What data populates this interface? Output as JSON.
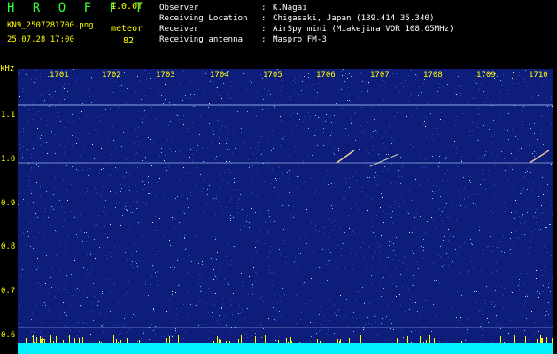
{
  "header": {
    "logo": "H R O F F T",
    "version": "1.0.0f",
    "filename": "KN9_2507281700.png",
    "mode_label": "meteor",
    "timestamp": "25.07.28 17:00",
    "count": "82"
  },
  "station_info": [
    {
      "key": "Observer",
      "value": "K.Nagai"
    },
    {
      "key": "Receiving Location",
      "value": "Chigasaki, Japan (139.414 35.340)"
    },
    {
      "key": "Receiver",
      "value": "AirSpy mini (Miakejima VOR 108.65MHz)"
    },
    {
      "key": "Receiving antenna",
      "value": "Maspro FM-3"
    }
  ],
  "spectrogram": {
    "y_unit": "kHz",
    "y_ticks": [
      "1.1",
      "1.0",
      "0.9",
      "0.8",
      "0.7",
      "0.6"
    ],
    "x_ticks": [
      "1701",
      "1702",
      "1703",
      "1704",
      "1705",
      "1706",
      "1707",
      "1708",
      "1709",
      "1710"
    ],
    "colors": {
      "background": "#0f1d7a",
      "noise_dim": "#2b49c9",
      "noise_bright": "#5fd0ff",
      "noise_hot": "#c8ffd6",
      "baseline": "#00f0ff",
      "axis_text": "#ffff00"
    }
  }
}
